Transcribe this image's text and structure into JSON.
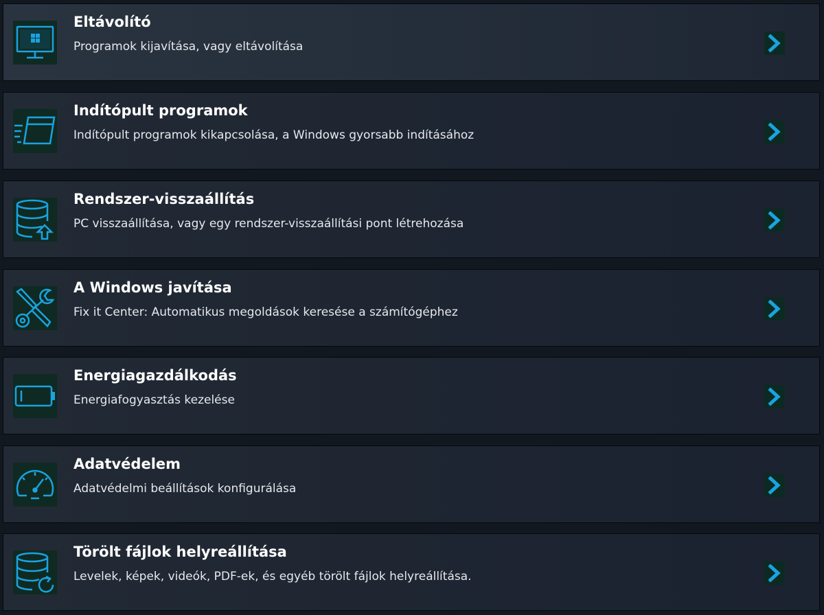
{
  "accent_color": "#1aa3e0",
  "items": [
    {
      "title": "Eltávolító",
      "subtitle": "Programok kijavítása, vagy eltávolítása",
      "icon": "monitor-windows-icon"
    },
    {
      "title": "Indítópult programok",
      "subtitle": "Indítópult programok kikapcsolása, a Windows gyorsabb indításához",
      "icon": "fast-window-icon"
    },
    {
      "title": "Rendszer-visszaállítás",
      "subtitle": "PC visszaállítása, vagy egy rendszer-visszaállítási pont létrehozása",
      "icon": "database-upload-icon"
    },
    {
      "title": "A Windows javítása",
      "subtitle": "Fix it Center: Automatikus megoldások keresése a számítógéphez",
      "icon": "wrench-screwdriver-icon"
    },
    {
      "title": "Energiagazdálkodás",
      "subtitle": "Energiafogyasztás kezelése",
      "icon": "battery-icon"
    },
    {
      "title": "Adatvédelem",
      "subtitle": "Adatvédelmi beállítások konfigurálása",
      "icon": "speedometer-icon"
    },
    {
      "title": "Törölt fájlok helyreállítása",
      "subtitle": "Levelek, képek, videók, PDF-ek, és egyéb törölt fájlok helyreállítása.",
      "icon": "database-restore-icon"
    }
  ]
}
